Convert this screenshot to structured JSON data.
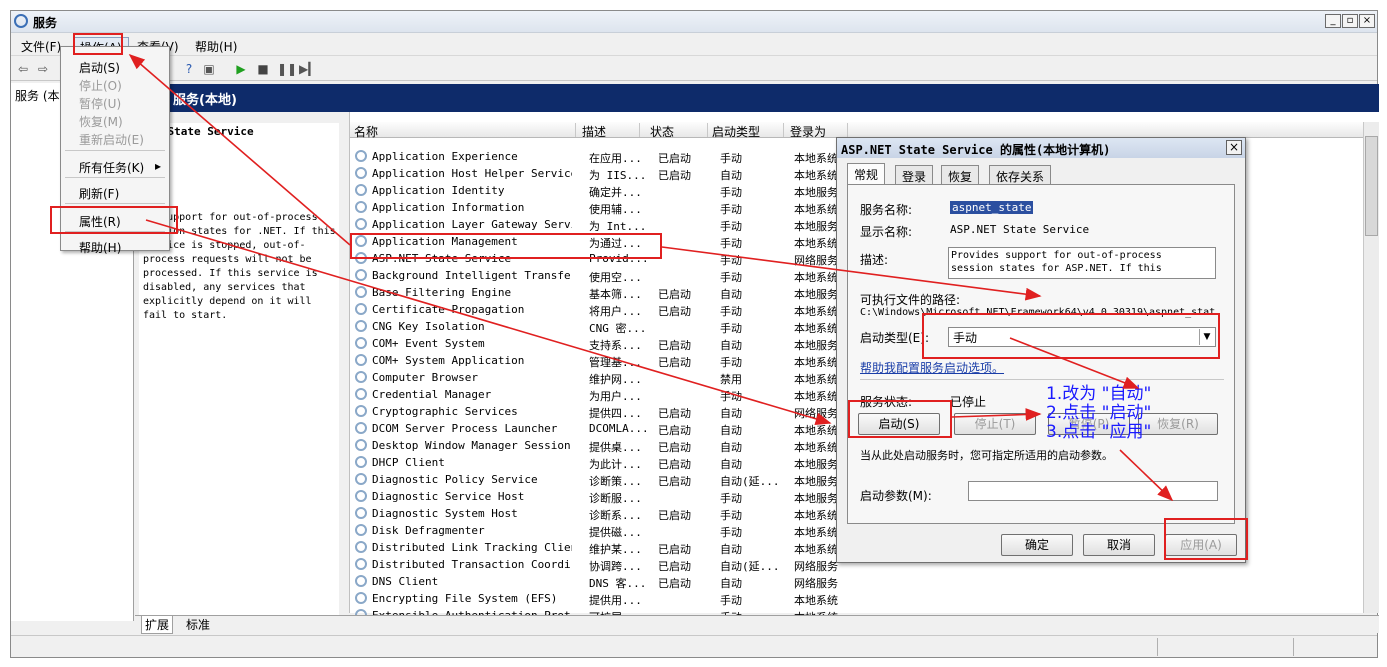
{
  "window": {
    "title": "服务",
    "min": "_",
    "max": "▫",
    "close": "×"
  },
  "menubar": [
    "文件(F)",
    "操作(A)",
    "查看(V)",
    "帮助(H)"
  ],
  "tree": {
    "root": "服务 (本"
  },
  "main": {
    "header": "服务(本地)",
    "selected_name": "NET State Service",
    "selected_link": "服务",
    "description": "es support for out-of-process session states for .NET. If this service is stopped, out-of-process requests will not be processed. If this service is disabled, any services that explicitly depend on it will fail to start."
  },
  "action_menu": [
    {
      "label": "启动(S)",
      "disabled": false
    },
    {
      "label": "停止(O)",
      "disabled": true
    },
    {
      "label": "暂停(U)",
      "disabled": true
    },
    {
      "label": "恢复(M)",
      "disabled": true
    },
    {
      "label": "重新启动(E)",
      "disabled": true
    },
    {
      "label": "所有任务(K)",
      "submenu": "▸"
    },
    {
      "label": "刷新(F)"
    },
    {
      "label": "属性(R)"
    },
    {
      "label": "帮助(H)"
    }
  ],
  "columns": [
    "名称",
    "描述",
    "状态",
    "启动类型",
    "登录为"
  ],
  "services": [
    [
      "Application Experience",
      "在应用...",
      "已启动",
      "手动",
      "本地系统"
    ],
    [
      "Application Host Helper Service",
      "为 IIS...",
      "已启动",
      "自动",
      "本地系统"
    ],
    [
      "Application Identity",
      "确定并...",
      "",
      "手动",
      "本地服务"
    ],
    [
      "Application Information",
      "使用辅...",
      "",
      "手动",
      "本地系统"
    ],
    [
      "Application Layer Gateway Service",
      "为 Int...",
      "",
      "手动",
      "本地服务"
    ],
    [
      "Application Management",
      "为通过...",
      "",
      "手动",
      "本地系统"
    ],
    [
      "ASP.NET State Service",
      "Provid...",
      "",
      "手动",
      "网络服务"
    ],
    [
      "Background Intelligent Transfe...",
      "使用空...",
      "",
      "手动",
      "本地系统"
    ],
    [
      "Base Filtering Engine",
      "基本筛...",
      "已启动",
      "自动",
      "本地服务"
    ],
    [
      "Certificate Propagation",
      "将用户...",
      "已启动",
      "手动",
      "本地系统"
    ],
    [
      "CNG Key Isolation",
      "CNG 密...",
      "",
      "手动",
      "本地系统"
    ],
    [
      "COM+ Event System",
      "支持系...",
      "已启动",
      "自动",
      "本地服务"
    ],
    [
      "COM+ System Application",
      "管理基...",
      "已启动",
      "手动",
      "本地系统"
    ],
    [
      "Computer Browser",
      "维护网...",
      "",
      "禁用",
      "本地系统"
    ],
    [
      "Credential Manager",
      "为用户...",
      "",
      "手动",
      "本地系统"
    ],
    [
      "Cryptographic Services",
      "提供四...",
      "已启动",
      "自动",
      "网络服务"
    ],
    [
      "DCOM Server Process Launcher",
      "DCOMLA...",
      "已启动",
      "自动",
      "本地系统"
    ],
    [
      "Desktop Window Manager Session...",
      "提供桌...",
      "已启动",
      "自动",
      "本地系统"
    ],
    [
      "DHCP Client",
      "为此计...",
      "已启动",
      "自动",
      "本地服务"
    ],
    [
      "Diagnostic Policy Service",
      "诊断策...",
      "已启动",
      "自动(延...",
      "本地服务"
    ],
    [
      "Diagnostic Service Host",
      "诊断服...",
      "",
      "手动",
      "本地服务"
    ],
    [
      "Diagnostic System Host",
      "诊断系...",
      "已启动",
      "手动",
      "本地系统"
    ],
    [
      "Disk Defragmenter",
      "提供磁...",
      "",
      "手动",
      "本地系统"
    ],
    [
      "Distributed Link Tracking Client",
      "维护某...",
      "已启动",
      "自动",
      "本地系统"
    ],
    [
      "Distributed Transaction Coordi...",
      "协调跨...",
      "已启动",
      "自动(延...",
      "网络服务"
    ],
    [
      "DNS Client",
      "DNS 客...",
      "已启动",
      "自动",
      "网络服务"
    ],
    [
      "Encrypting File System (EFS)",
      "提供用...",
      "",
      "手动",
      "本地系统"
    ],
    [
      "Extensible Authentication Prot...",
      "可扩展...",
      "",
      "手动",
      "本地系统"
    ]
  ],
  "bottom_tabs": [
    "扩展",
    "标准"
  ],
  "dialog": {
    "title": "ASP.NET State Service 的属性(本地计算机)",
    "close": "×",
    "tabs": [
      "常规",
      "登录",
      "恢复",
      "依存关系"
    ],
    "service_name_label": "服务名称:",
    "service_name": "aspnet_state",
    "display_name_label": "显示名称:",
    "display_name": "ASP.NET State Service",
    "desc_label": "描述:",
    "desc": "Provides support for out-of-process session states for ASP.NET. If this",
    "path_label": "可执行文件的路径:",
    "path": "C:\\Windows\\Microsoft.NET\\Framework64\\v4.0.30319\\aspnet_stat",
    "startup_label": "启动类型(E):",
    "startup_value": "手动",
    "help_link": "帮助我配置服务启动选项。",
    "status_label": "服务状态:",
    "status_value": "已停止",
    "btn_start": "启动(S)",
    "btn_stop": "停止(T)",
    "btn_pause": "暂停(P)",
    "btn_resume": "恢复(R)",
    "hint": "当从此处启动服务时，您可指定所适用的启动参数。",
    "param_label": "启动参数(M):",
    "ok": "确定",
    "cancel": "取消",
    "apply": "应用(A)"
  },
  "notes": [
    "1.改为 \"自动\"",
    "2.点击 \"启动\"",
    "3.点击 \"应用\""
  ],
  "colors": {
    "header_bg": "#0e2b6a",
    "highlight": "#e02020",
    "note": "#1a1aff"
  }
}
